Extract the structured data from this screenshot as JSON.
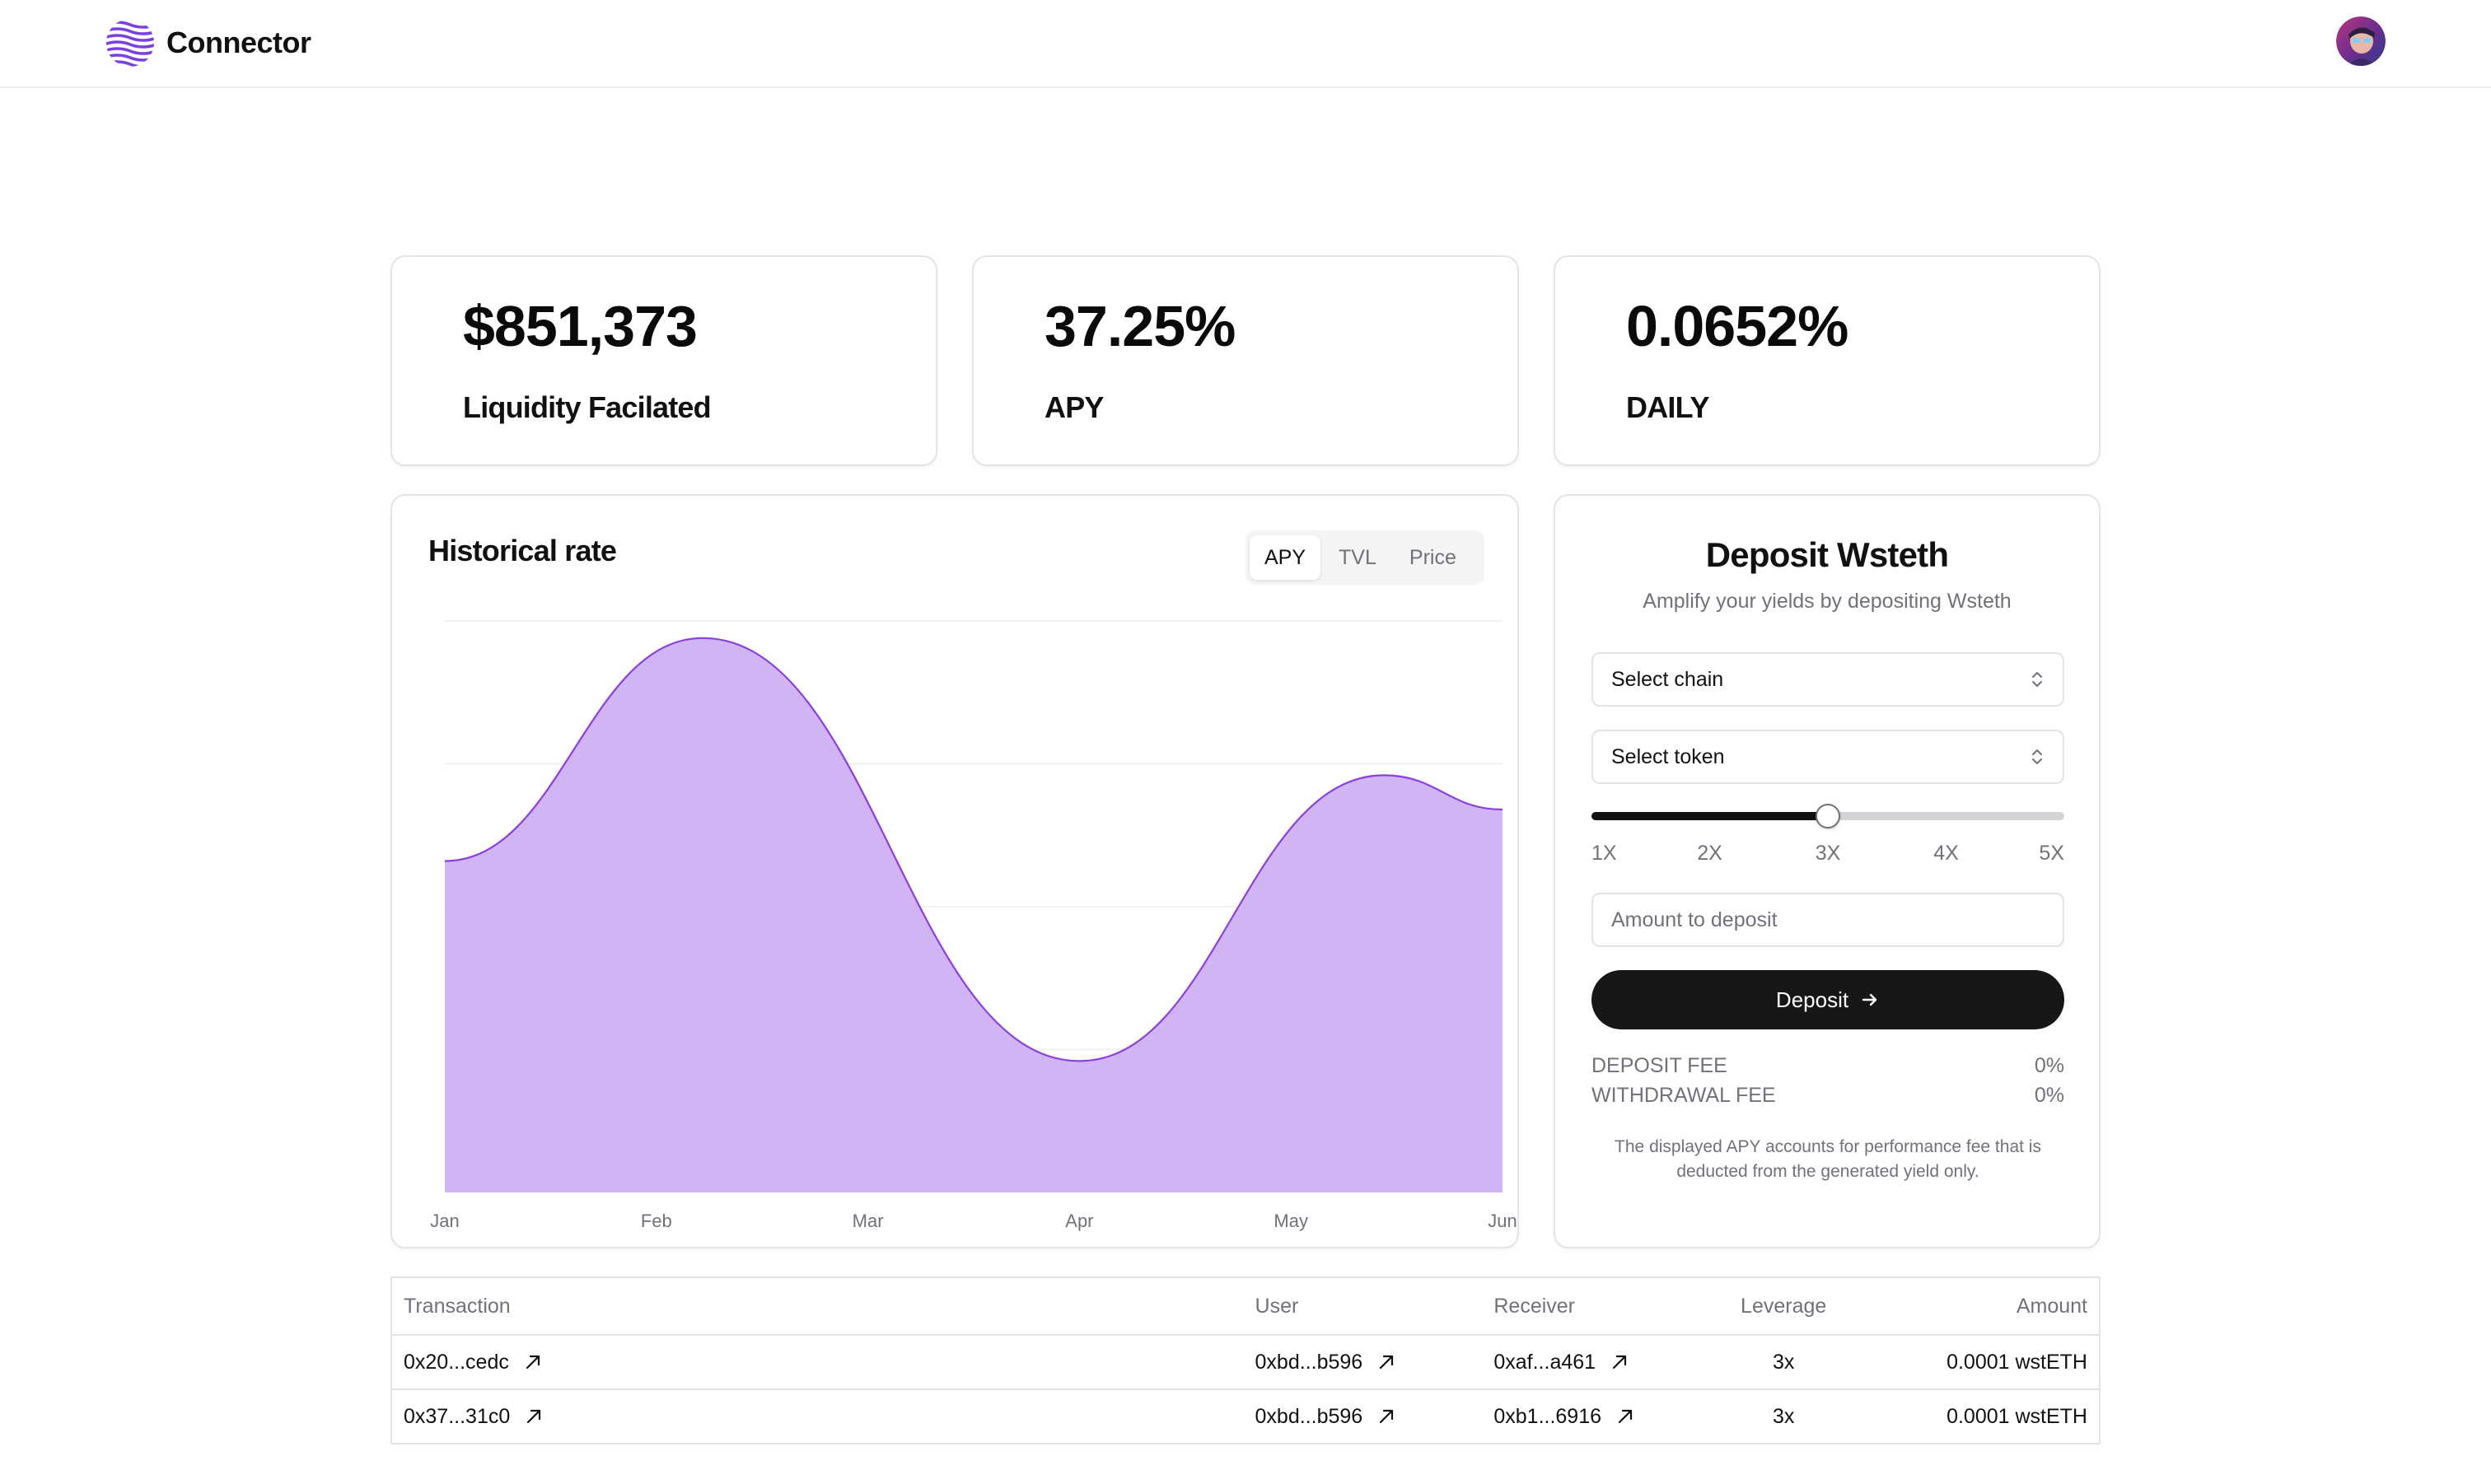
{
  "header": {
    "brand": "Connector"
  },
  "stats": [
    {
      "value": "$851,373",
      "label": "Liquidity Facilated"
    },
    {
      "value": "37.25%",
      "label": "APY"
    },
    {
      "value": "0.0652%",
      "label": "DAILY"
    }
  ],
  "historical": {
    "title": "Historical rate",
    "tabs": [
      {
        "label": "APY",
        "active": true
      },
      {
        "label": "TVL",
        "active": false
      },
      {
        "label": "Price",
        "active": false
      }
    ]
  },
  "chart_data": {
    "type": "area",
    "x": [
      "Jan",
      "Feb",
      "Mar",
      "Apr",
      "May",
      "Jun"
    ],
    "points": [
      {
        "x": 0.0,
        "y": 58
      },
      {
        "x": 1.22,
        "y": 97
      },
      {
        "x": 3.0,
        "y": 23
      },
      {
        "x": 4.44,
        "y": 73
      },
      {
        "x": 5.0,
        "y": 67
      }
    ],
    "ylim": [
      0,
      100
    ],
    "grid": "horizontal",
    "colors": {
      "fill": "#cfb0f2",
      "line": "#8b3fe0"
    }
  },
  "deposit": {
    "title": "Deposit Wsteth",
    "subtitle": "Amplify your yields by depositing Wsteth",
    "chain_placeholder": "Select chain",
    "token_placeholder": "Select token",
    "leverage_options": [
      "1X",
      "2X",
      "3X",
      "4X",
      "5X"
    ],
    "leverage_value": 0.5,
    "amount_placeholder": "Amount to deposit",
    "button_label": "Deposit",
    "fees": [
      {
        "label": "DEPOSIT FEE",
        "value": "0%"
      },
      {
        "label": "WITHDRAWAL FEE",
        "value": "0%"
      }
    ],
    "disclaimer": "The displayed APY accounts for performance fee that is deducted from the generated yield only."
  },
  "transactions": {
    "columns": [
      "Transaction",
      "User",
      "Receiver",
      "Leverage",
      "Amount"
    ],
    "rows": [
      {
        "tx": "0x20...cedc",
        "user": "0xbd...b596",
        "receiver": "0xaf...a461",
        "leverage": "3x",
        "amount": "0.0001 wstETH"
      },
      {
        "tx": "0x37...31c0",
        "user": "0xbd...b596",
        "receiver": "0xb1...6916",
        "leverage": "3x",
        "amount": "0.0001 wstETH"
      }
    ]
  }
}
